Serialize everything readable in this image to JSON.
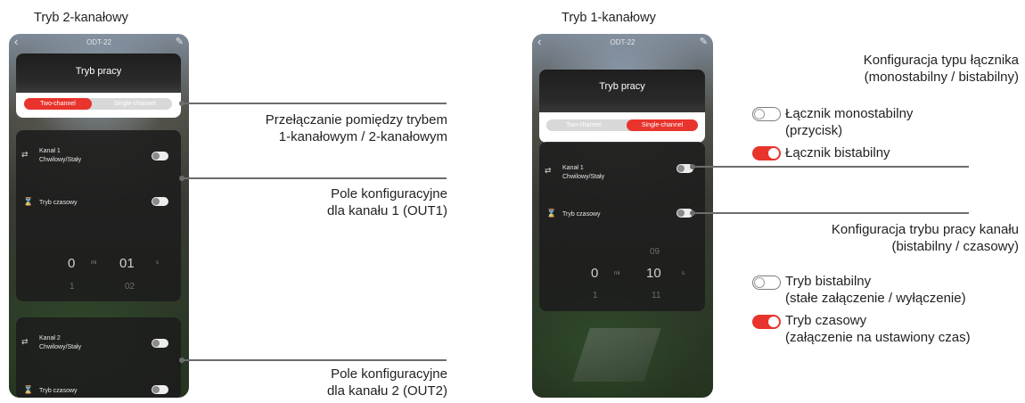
{
  "left": {
    "caption": "Tryb 2-kanałowy",
    "app_title": "ODT-22",
    "mode_title": "Tryb pracy",
    "seg_two": "Two-channel",
    "seg_single": "Single-channel",
    "ch1_name": "Kanał 1",
    "ch1_sub": "Chwilowy/Stały",
    "timer_label": "Tryb czasowy",
    "picker_min": "0",
    "picker_min_unit": "mi",
    "picker_sec": "01",
    "picker_sec_unit": "s",
    "picker_min_next": "1",
    "picker_sec_next": "02",
    "ch2_name": "Kanał 2",
    "ch2_sub": "Chwilowy/Stały",
    "timer2_label": "Tryb czasowy"
  },
  "right": {
    "caption": "Tryb 1-kanałowy",
    "app_title": "ODT-22",
    "mode_title": "Tryb pracy",
    "seg_two": "Two-channel",
    "seg_single": "Single-channel",
    "ch1_name": "Kanał 1",
    "ch1_sub": "Chwilowy/Stały",
    "timer_label": "Tryb czasowy",
    "picker_sec_prev": "09",
    "picker_min": "0",
    "picker_min_unit": "mi",
    "picker_sec": "10",
    "picker_sec_unit": "s",
    "picker_min_next": "1",
    "picker_sec_next": "11"
  },
  "notes": {
    "switch_mode_1": "Przełączanie pomiędzy trybem",
    "switch_mode_2": "1-kanałowym / 2-kanałowym",
    "field_ch1_1": "Pole konfiguracyjne",
    "field_ch1_2": "dla kanału 1 (OUT1)",
    "field_ch2_1": "Pole konfiguracyjne",
    "field_ch2_2": "dla kanału 2 (OUT2)",
    "switch_type_1": "Konfiguracja typu łącznika",
    "switch_type_2": "(monostabilny / bistabilny)",
    "mono_1": "Łącznik monostabilny",
    "mono_2": "(przycisk)",
    "bistable": "Łącznik bistabilny",
    "channel_mode_1": "Konfiguracja trybu pracy kanału",
    "channel_mode_2": "(bistabilny / czasowy)",
    "bi_mode_1": "Tryb bistabilny",
    "bi_mode_2": "(stałe załączenie / wyłączenie)",
    "timed_1": "Tryb czasowy",
    "timed_2": "(załączenie na ustawiony czas)"
  },
  "colors": {
    "accent_red": "#e8342c",
    "leader_gray": "#6d6d6d",
    "text": "#231f20"
  }
}
